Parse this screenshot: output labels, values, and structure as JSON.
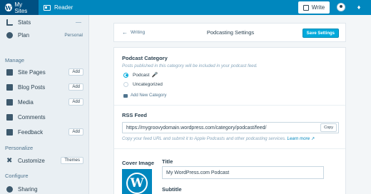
{
  "masterbar": {
    "my_sites": "My Sites",
    "reader": "Reader",
    "write": "Write"
  },
  "sidebar": {
    "stats": "Stats",
    "plan": "Plan",
    "plan_value": "Personal",
    "manage_heading": "Manage",
    "site_pages": "Site Pages",
    "blog_posts": "Blog Posts",
    "media": "Media",
    "comments": "Comments",
    "feedback": "Feedback",
    "add_label": "Add",
    "personalize_heading": "Personalize",
    "customize": "Customize",
    "themes": "Themes",
    "configure_heading": "Configure",
    "sharing": "Sharing"
  },
  "header": {
    "back": "Writing",
    "title": "Podcasting Settings",
    "save": "Save Settings"
  },
  "category": {
    "title": "Podcast Category",
    "help": "Posts published in this category will be included in your podcast feed.",
    "options": [
      "Podcast",
      "Uncategorized"
    ],
    "selected": "Podcast",
    "add_new": "Add New Category"
  },
  "rss": {
    "title": "RSS Feed",
    "url": "https://mygroovydomain.wordpress.com/category/podcast/feed/",
    "copy": "Copy",
    "help": "Copy your feed URL and submit it to Apple Podcasts and other podcasting services.",
    "learn_more": "Learn more"
  },
  "cover": {
    "label": "Cover Image"
  },
  "fields": {
    "title_label": "Title",
    "title_value": "My WordPress.com Podcast",
    "subtitle_label": "Subtitle"
  },
  "colors": {
    "masterbar": "#0087be",
    "masterbar_active": "#005082",
    "accent_button": "#00aadc",
    "mic_icon": "#c95cf7"
  }
}
